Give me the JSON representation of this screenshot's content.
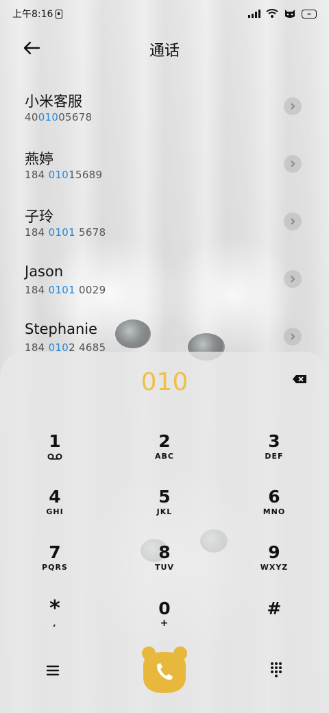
{
  "status_bar": {
    "time": "上午8:16"
  },
  "header": {
    "title": "通话"
  },
  "contacts": [
    {
      "name": "小米客服",
      "number_pre": "40",
      "number_hl": "010",
      "number_post": "05678"
    },
    {
      "name": "燕婷",
      "number_pre": "184 ",
      "number_hl": "010",
      "number_post": "15689"
    },
    {
      "name": "子玲",
      "number_pre": "184 ",
      "number_hl": "0101",
      "number_post": " 5678"
    },
    {
      "name": "Jason",
      "number_pre": "184 ",
      "number_hl": "0101",
      "number_post": " 0029"
    },
    {
      "name": "Stephanie",
      "number_pre": "184 ",
      "number_hl": "010",
      "number_post": "2 4685"
    }
  ],
  "dialer": {
    "input": "010",
    "keys": [
      {
        "digit": "1",
        "letters": ""
      },
      {
        "digit": "2",
        "letters": "ABC"
      },
      {
        "digit": "3",
        "letters": "DEF"
      },
      {
        "digit": "4",
        "letters": "GHI"
      },
      {
        "digit": "5",
        "letters": "JKL"
      },
      {
        "digit": "6",
        "letters": "MNO"
      },
      {
        "digit": "7",
        "letters": "PQRS"
      },
      {
        "digit": "8",
        "letters": "TUV"
      },
      {
        "digit": "9",
        "letters": "WXYZ"
      },
      {
        "digit": "*",
        "letters": ","
      },
      {
        "digit": "0",
        "letters": "+"
      },
      {
        "digit": "#",
        "letters": ""
      }
    ]
  },
  "colors": {
    "accent": "#f0c045",
    "highlight": "#2a86d8",
    "call_button": "#e8b83c"
  },
  "icons": {
    "back": "arrow-left-icon",
    "chevron": "chevron-right-icon",
    "backspace": "backspace-icon",
    "voicemail": "voicemail-icon",
    "menu": "menu-icon",
    "call": "phone-icon",
    "dialpad": "dialpad-icon"
  }
}
